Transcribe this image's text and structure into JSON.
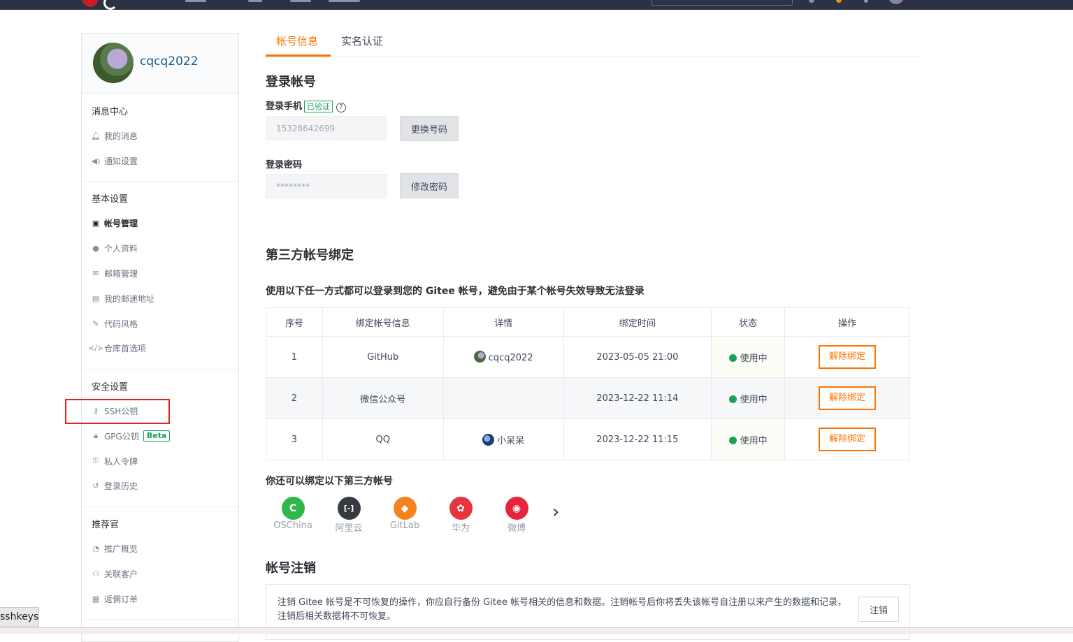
{
  "user": {
    "username": "cqcq2022"
  },
  "tabs": [
    {
      "label": "帐号信息"
    },
    {
      "label": "实名认证"
    }
  ],
  "sidebar": {
    "sections": [
      {
        "title": "消息中心",
        "items": [
          {
            "label": "我的消息",
            "icon": "bell-icon"
          },
          {
            "label": "通知设置",
            "icon": "volume-icon"
          }
        ]
      },
      {
        "title": "基本设置",
        "items": [
          {
            "label": "帐号管理",
            "icon": "id-card-icon",
            "active": true
          },
          {
            "label": "个人资料",
            "icon": "user-icon"
          },
          {
            "label": "邮箱管理",
            "icon": "envelope-icon"
          },
          {
            "label": "我的邮递地址",
            "icon": "address-card-icon"
          },
          {
            "label": "代码风格",
            "icon": "brush-icon"
          },
          {
            "label": "仓库首选项",
            "icon": "code-icon"
          }
        ]
      },
      {
        "title": "安全设置",
        "items": [
          {
            "label": "SSH公钥",
            "icon": "key-icon"
          },
          {
            "label": "GPG公钥",
            "icon": "lock-icon",
            "badge": "Beta"
          },
          {
            "label": "私人令牌",
            "icon": "token-icon"
          },
          {
            "label": "登录历史",
            "icon": "history-icon"
          }
        ]
      },
      {
        "title": "推荐官",
        "items": [
          {
            "label": "推广概览",
            "icon": "chart-icon"
          },
          {
            "label": "关联客户",
            "icon": "user-link-icon"
          },
          {
            "label": "返佣订单",
            "icon": "order-icon"
          }
        ]
      }
    ]
  },
  "login": {
    "title": "登录帐号",
    "phone_label": "登录手机",
    "phone_badge": "已验证",
    "help": "?",
    "phone_value": "15328642699",
    "change_phone_btn": "更换号码",
    "password_label": "登录密码",
    "password_value": "********",
    "change_password_btn": "修改密码"
  },
  "third_party": {
    "title": "第三方帐号绑定",
    "description": "使用以下任一方式都可以登录到您的 Gitee 帐号，避免由于某个帐号失效导致无法登录",
    "columns": [
      "序号",
      "绑定帐号信息",
      "详情",
      "绑定时间",
      "状态",
      "操作"
    ],
    "rows": [
      {
        "no": "1",
        "account": "GitHub",
        "detail": "cqcq2022",
        "time": "2023-05-05 21:00",
        "status": "使用中",
        "action": "解除绑定"
      },
      {
        "no": "2",
        "account": "微信公众号",
        "detail": "",
        "time": "2023-12-22 11:14",
        "status": "使用中",
        "action": "解除绑定"
      },
      {
        "no": "3",
        "account": "QQ",
        "detail": "小呆呆",
        "time": "2023-12-22 11:15",
        "status": "使用中",
        "action": "解除绑定"
      }
    ],
    "more_title": "你还可以绑定以下第三方帐号",
    "providers": [
      {
        "name": "OSChina",
        "color": "#2fb74a",
        "glyph": "C"
      },
      {
        "name": "阿里云",
        "color": "#373b41",
        "glyph": "[-]"
      },
      {
        "name": "GitLab",
        "color": "#f4831f",
        "glyph": "◆"
      },
      {
        "name": "华为",
        "color": "#e6353e",
        "glyph": "✿"
      },
      {
        "name": "微博",
        "color": "#e6253c",
        "glyph": "◉"
      }
    ],
    "next": "›"
  },
  "cancel": {
    "title": "帐号注销",
    "text": "注销 Gitee 帐号是不可恢复的操作，你应自行备份 Gitee 帐号相关的信息和数据。注销帐号后你将丢失该帐号自注册以来产生的数据和记录，注销后相关数据将不可恢复。",
    "button": "注销"
  },
  "tooltip": {
    "text": "sshkeys"
  },
  "colors": {
    "accent": "#fe7300",
    "success": "#1aa157",
    "highlight": "#e52222",
    "nav": "#2b3343"
  }
}
